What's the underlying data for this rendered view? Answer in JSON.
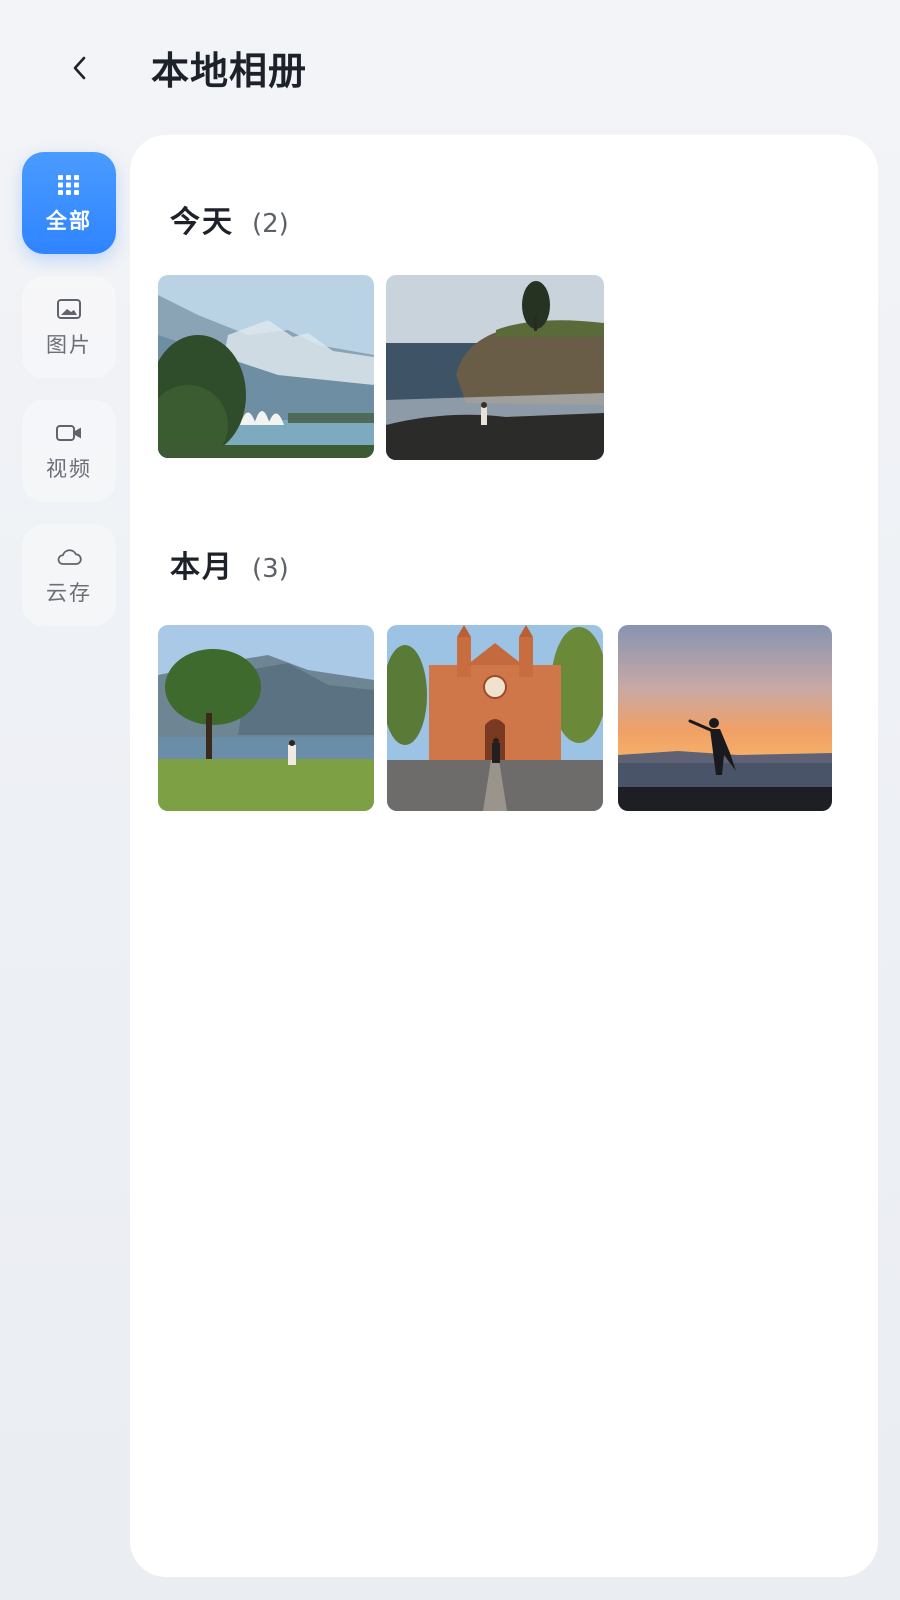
{
  "header": {
    "title": "本地相册",
    "back_icon": "chevron-left-icon"
  },
  "sidebar": {
    "items": [
      {
        "label": "全部",
        "icon": "grid-icon",
        "active": true
      },
      {
        "label": "图片",
        "icon": "image-icon",
        "active": false
      },
      {
        "label": "视频",
        "icon": "video-icon",
        "active": false
      },
      {
        "label": "云存",
        "icon": "cloud-icon",
        "active": false
      }
    ]
  },
  "sections": [
    {
      "title": "今天",
      "count": "(2)",
      "photos": [
        {
          "subject": "mountain-lake-opera-house"
        },
        {
          "subject": "coastal-cliff-person"
        }
      ]
    },
    {
      "title": "本月",
      "count": "(3)",
      "photos": [
        {
          "subject": "lakeside-tree-mountains"
        },
        {
          "subject": "church-plaza-person"
        },
        {
          "subject": "sunset-silhouette-sea"
        }
      ]
    }
  ],
  "colors": {
    "accent": "#2f84ff",
    "title_text": "#1d2129",
    "muted_text": "#6b6f78",
    "card_bg": "#ffffff"
  }
}
